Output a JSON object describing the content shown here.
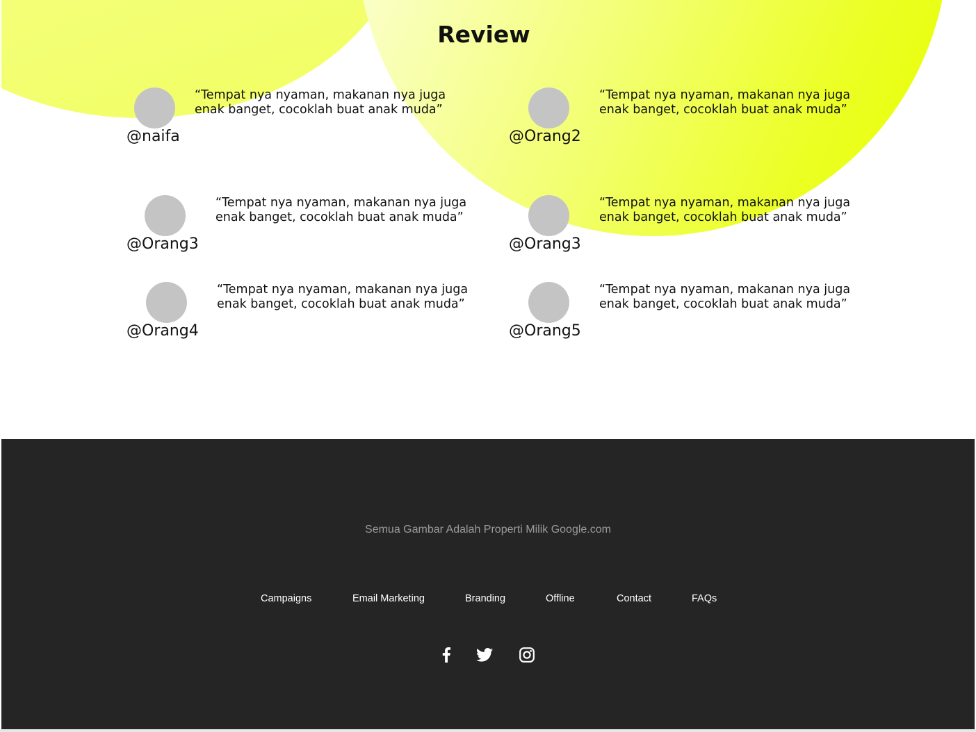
{
  "review": {
    "title": "Review",
    "items": [
      {
        "handle": "@naifa",
        "quote_line1": "“Tempat nya nyaman, makanan nya juga",
        "quote_line2": "enak banget, cocoklah buat anak muda”"
      },
      {
        "handle": "@Orang2",
        "quote_line1": "“Tempat nya nyaman, makanan nya juga",
        "quote_line2": "enak banget, cocoklah buat anak muda”"
      },
      {
        "handle": "@Orang3",
        "quote_line1": "“Tempat nya nyaman, makanan nya juga",
        "quote_line2": "enak banget, cocoklah buat anak muda”"
      },
      {
        "handle": "@Orang3",
        "quote_line1": "“Tempat nya nyaman, makanan nya juga",
        "quote_line2": "enak banget, cocoklah buat anak muda”"
      },
      {
        "handle": "@Orang4",
        "quote_line1": "“Tempat nya nyaman, makanan nya juga",
        "quote_line2": "enak banget, cocoklah buat anak muda”"
      },
      {
        "handle": "@Orang5",
        "quote_line1": "“Tempat nya nyaman, makanan nya juga",
        "quote_line2": "enak banget, cocoklah buat anak muda”"
      }
    ]
  },
  "footer": {
    "copyright": "Semua Gambar Adalah Properti Milik Google.com",
    "nav": [
      "Campaigns",
      "Email Marketing",
      "Branding",
      "Offline",
      "Contact",
      "FAQs"
    ],
    "social_icons": [
      "facebook-icon",
      "twitter-icon",
      "instagram-icon"
    ]
  },
  "colors": {
    "accent_yellow": "#e6ff00",
    "footer_bg": "#252525",
    "avatar_gray": "#c4c4c4"
  }
}
